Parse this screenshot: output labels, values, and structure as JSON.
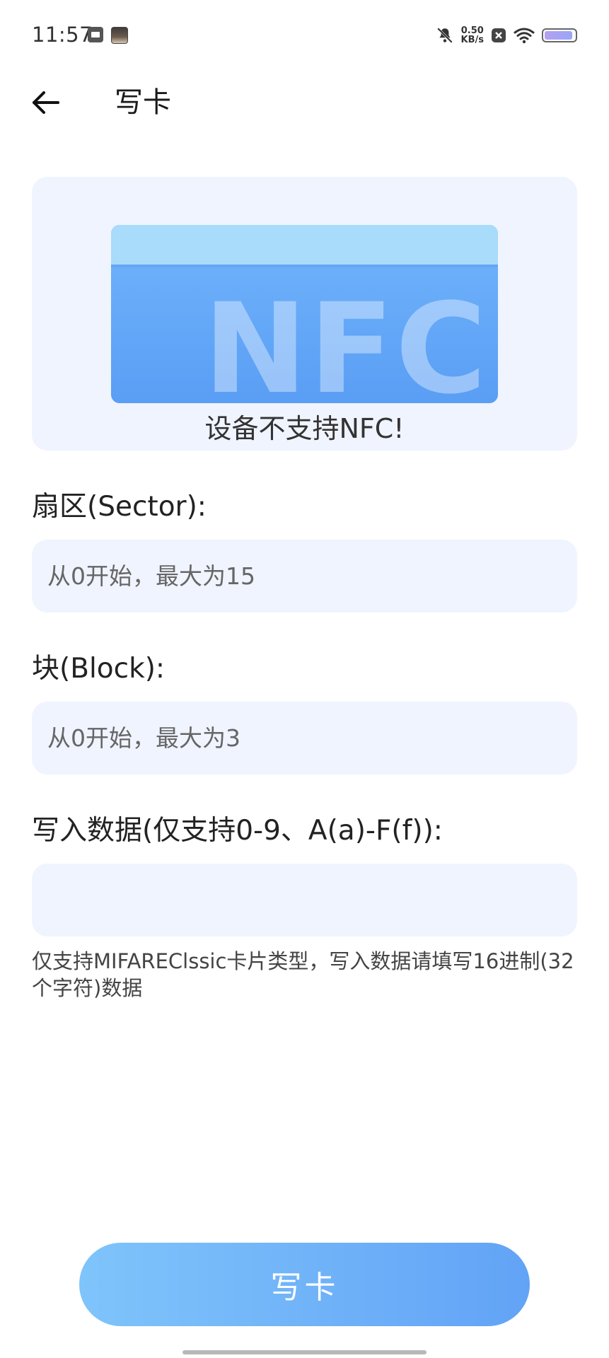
{
  "status_bar": {
    "time": "11:57",
    "net_speed_value": "0.50",
    "net_speed_unit": "KB/s",
    "battery_level": 0.92,
    "icons": [
      "gallery-icon",
      "avatar-icon",
      "mute-icon",
      "close-square-icon",
      "wifi-icon",
      "battery-icon"
    ]
  },
  "toolbar": {
    "title": "写卡",
    "back_icon": "arrow-left-icon"
  },
  "nfc_panel": {
    "card_logo": "NFC",
    "status": "设备不支持NFC!"
  },
  "form": {
    "sector": {
      "label": "扇区(Sector):",
      "value": "",
      "placeholder": "从0开始，最大为15"
    },
    "block": {
      "label": "块(Block):",
      "value": "",
      "placeholder": "从0开始，最大为3"
    },
    "data": {
      "label": "写入数据(仅支持0-9、A(a)-F(f)):",
      "value": "",
      "placeholder": ""
    },
    "hint": "仅支持MIFAREClssic卡片类型，写入数据请填写16进制(32个字符)数据"
  },
  "actions": {
    "write_label": "写卡"
  },
  "colors": {
    "accent_start": "#7fc4fb",
    "accent_end": "#62a3f6",
    "input_bg": "#f0f4ff",
    "card_top": "#a9dbfb",
    "card_body": "#5a9ef5"
  }
}
